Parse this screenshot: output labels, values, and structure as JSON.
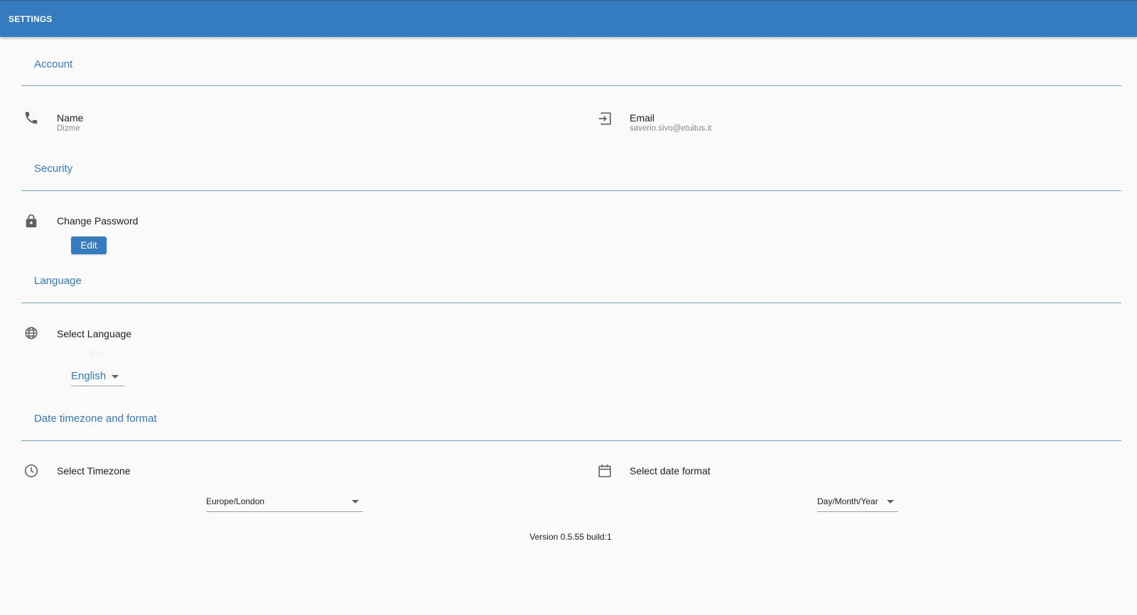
{
  "appbar": {
    "title": "SETTINGS"
  },
  "account": {
    "title": "Account",
    "name_label": "Name",
    "name_value": "Dizme",
    "email_label": "Email",
    "email_value": "saverio.sivo@etuitus.it"
  },
  "security": {
    "title": "Security",
    "change_password_label": "Change Password",
    "edit_button": "Edit"
  },
  "language": {
    "title": "Language",
    "select_label": "Select Language",
    "ghost_text": "Edit",
    "selected": "English"
  },
  "datetime": {
    "title": "Date timezone and format",
    "timezone_label": "Select Timezone",
    "timezone_selected": "Europe/London",
    "dateformat_label": "Select date format",
    "dateformat_selected": "Day/Month/Year"
  },
  "footer": {
    "version": "Version 0.5.55 build:1"
  },
  "colors": {
    "primary": "#347bbf",
    "background": "#fafafa",
    "icon": "#616161"
  },
  "icons": {
    "name": "phone-icon",
    "email": "login-icon",
    "password": "lock-icon",
    "language": "globe-icon",
    "timezone": "clock-icon",
    "dateformat": "calendar-icon"
  }
}
